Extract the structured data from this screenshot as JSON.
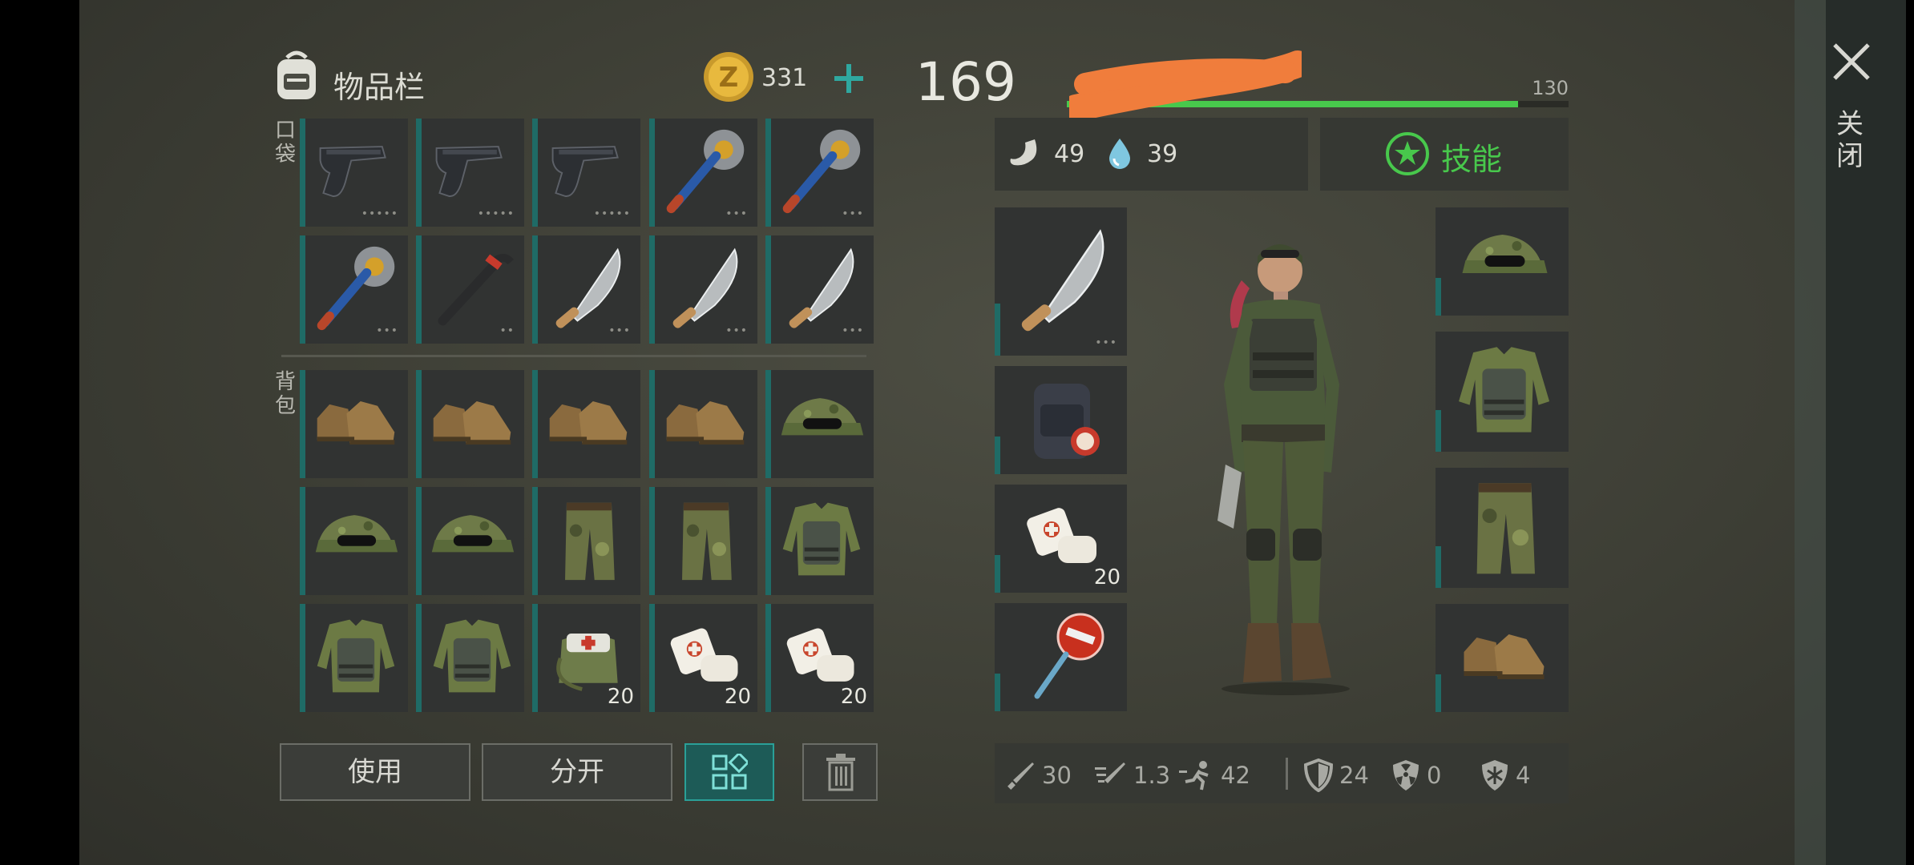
{
  "header": {
    "title": "物品栏",
    "coins": "331"
  },
  "sections": {
    "pocket": "口袋",
    "backpack": "背包"
  },
  "pocket_items": [
    {
      "icon": "pistol-icon",
      "dots": "•••••"
    },
    {
      "icon": "pistol-icon",
      "dots": "•••••"
    },
    {
      "icon": "pistol-icon",
      "dots": "•••••"
    },
    {
      "icon": "saw-mace-icon",
      "dots": "•••"
    },
    {
      "icon": "saw-mace-icon",
      "dots": "•••"
    },
    {
      "icon": "saw-mace-icon",
      "dots": "•••"
    },
    {
      "icon": "crowbar-icon",
      "dots": "••"
    },
    {
      "icon": "machete-icon",
      "dots": "•••"
    },
    {
      "icon": "machete-icon",
      "dots": "•••"
    },
    {
      "icon": "machete-icon",
      "dots": "•••"
    }
  ],
  "backpack_items": [
    {
      "icon": "boots-icon",
      "count": ""
    },
    {
      "icon": "boots-icon",
      "count": ""
    },
    {
      "icon": "boots-icon",
      "count": ""
    },
    {
      "icon": "boots-icon",
      "count": ""
    },
    {
      "icon": "camo-cap-icon",
      "count": ""
    },
    {
      "icon": "camo-cap-icon",
      "count": ""
    },
    {
      "icon": "camo-cap-icon",
      "count": ""
    },
    {
      "icon": "camo-pants-icon",
      "count": ""
    },
    {
      "icon": "camo-pants-icon",
      "count": ""
    },
    {
      "icon": "camo-vest-icon",
      "count": ""
    },
    {
      "icon": "camo-vest-icon",
      "count": ""
    },
    {
      "icon": "camo-vest-icon",
      "count": ""
    },
    {
      "icon": "medkit-bag-icon",
      "count": "20"
    },
    {
      "icon": "bandage-icon",
      "count": "20"
    },
    {
      "icon": "bandage-icon",
      "count": "20"
    }
  ],
  "buttons": {
    "use": "使用",
    "split": "分开"
  },
  "player": {
    "health": "169",
    "max": "130",
    "health_fill": 0.9,
    "hunger": "49",
    "thirst": "39",
    "skills_label": "技能"
  },
  "equipment_left": [
    {
      "icon": "machete-icon",
      "dots": "•••",
      "count": ""
    },
    {
      "icon": "backpack-icon",
      "dots": "",
      "count": ""
    },
    {
      "icon": "bandage-icon",
      "dots": "",
      "count": "20"
    },
    {
      "icon": "stop-sign-icon",
      "dots": "",
      "count": ""
    }
  ],
  "equipment_right": [
    {
      "icon": "camo-cap-icon"
    },
    {
      "icon": "camo-vest-icon"
    },
    {
      "icon": "camo-pants-icon"
    },
    {
      "icon": "boots-icon"
    }
  ],
  "stats": {
    "attack": "30",
    "speed": "1.3",
    "movement": "42",
    "defense": "24",
    "radiation": "0",
    "cold": "4"
  },
  "close_label": "关闭",
  "colors": {
    "accent_teal": "#1f6b66",
    "green": "#48c84c",
    "orange_scribble": "#f07d3c"
  }
}
